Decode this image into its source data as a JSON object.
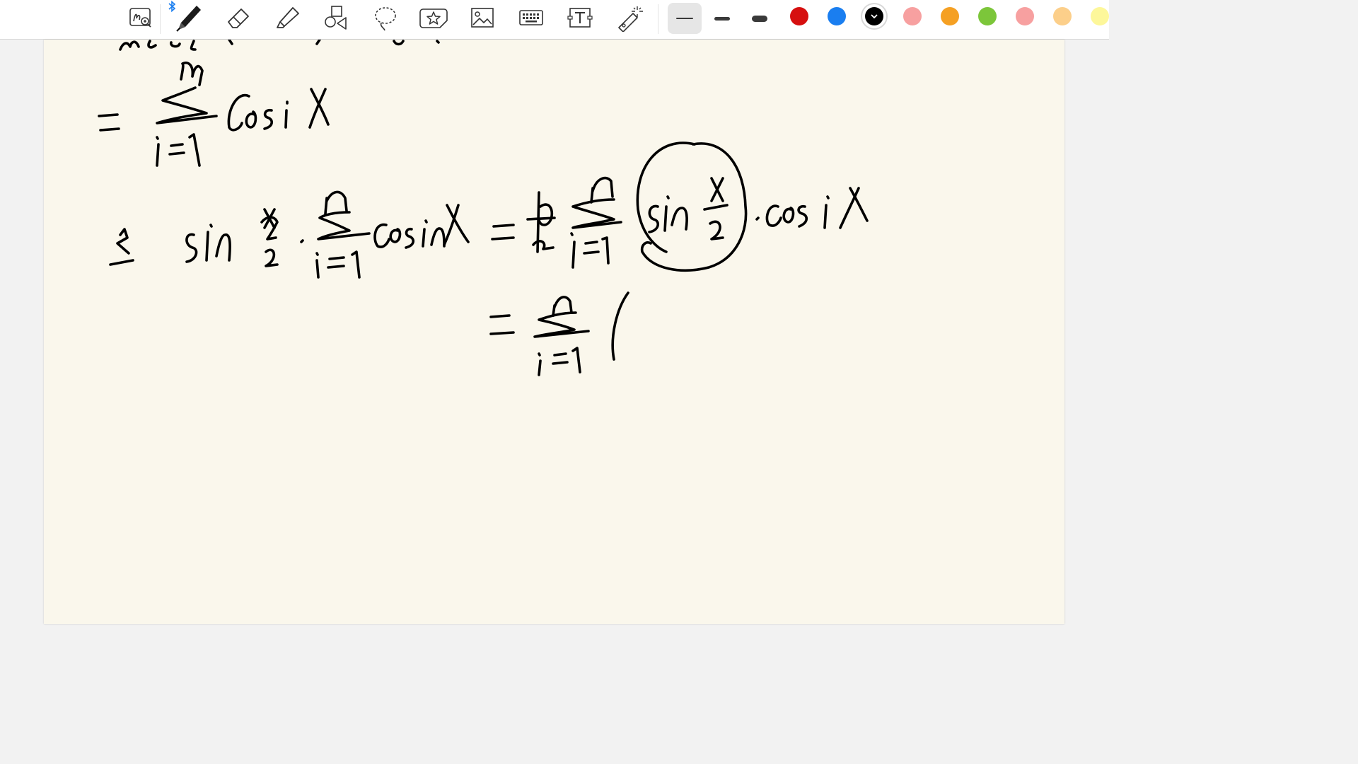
{
  "toolbar": {
    "tools": [
      {
        "name": "zoom-window-tool",
        "icon": "zoom-window-icon"
      },
      {
        "name": "pen-tool",
        "icon": "pen-icon",
        "selected": true,
        "bluetooth_connected": true
      },
      {
        "name": "eraser-tool",
        "icon": "eraser-icon"
      },
      {
        "name": "highlighter-tool",
        "icon": "highlighter-icon"
      },
      {
        "name": "shapes-tool",
        "icon": "shapes-icon"
      },
      {
        "name": "lasso-tool",
        "icon": "lasso-icon"
      },
      {
        "name": "sticker-tool",
        "icon": "star-sticker-icon"
      },
      {
        "name": "image-tool",
        "icon": "image-icon"
      },
      {
        "name": "keyboard-tool",
        "icon": "keyboard-icon"
      },
      {
        "name": "text-tool",
        "icon": "text-box-icon",
        "glyph": "T"
      },
      {
        "name": "laser-pointer-tool",
        "icon": "laser-pointer-icon"
      }
    ],
    "stroke_widths": [
      {
        "name": "thin",
        "selected": true
      },
      {
        "name": "medium",
        "selected": false
      },
      {
        "name": "thick",
        "selected": false
      }
    ],
    "colors": [
      {
        "hex": "#d60f0f",
        "selected": false
      },
      {
        "hex": "#1a7ef0",
        "selected": false
      },
      {
        "hex": "#000000",
        "selected": true
      },
      {
        "hex": "#f7a0a0",
        "selected": false
      },
      {
        "hex": "#f5a023",
        "selected": false
      },
      {
        "hex": "#7cc63a",
        "selected": false
      },
      {
        "hex": "#f7a0a0",
        "selected": false
      },
      {
        "hex": "#fccf8a",
        "selected": false
      },
      {
        "hex": "#fdf79a",
        "selected": false
      }
    ]
  },
  "page": {
    "background": "#faf7ec",
    "ink_color": "#000000"
  }
}
